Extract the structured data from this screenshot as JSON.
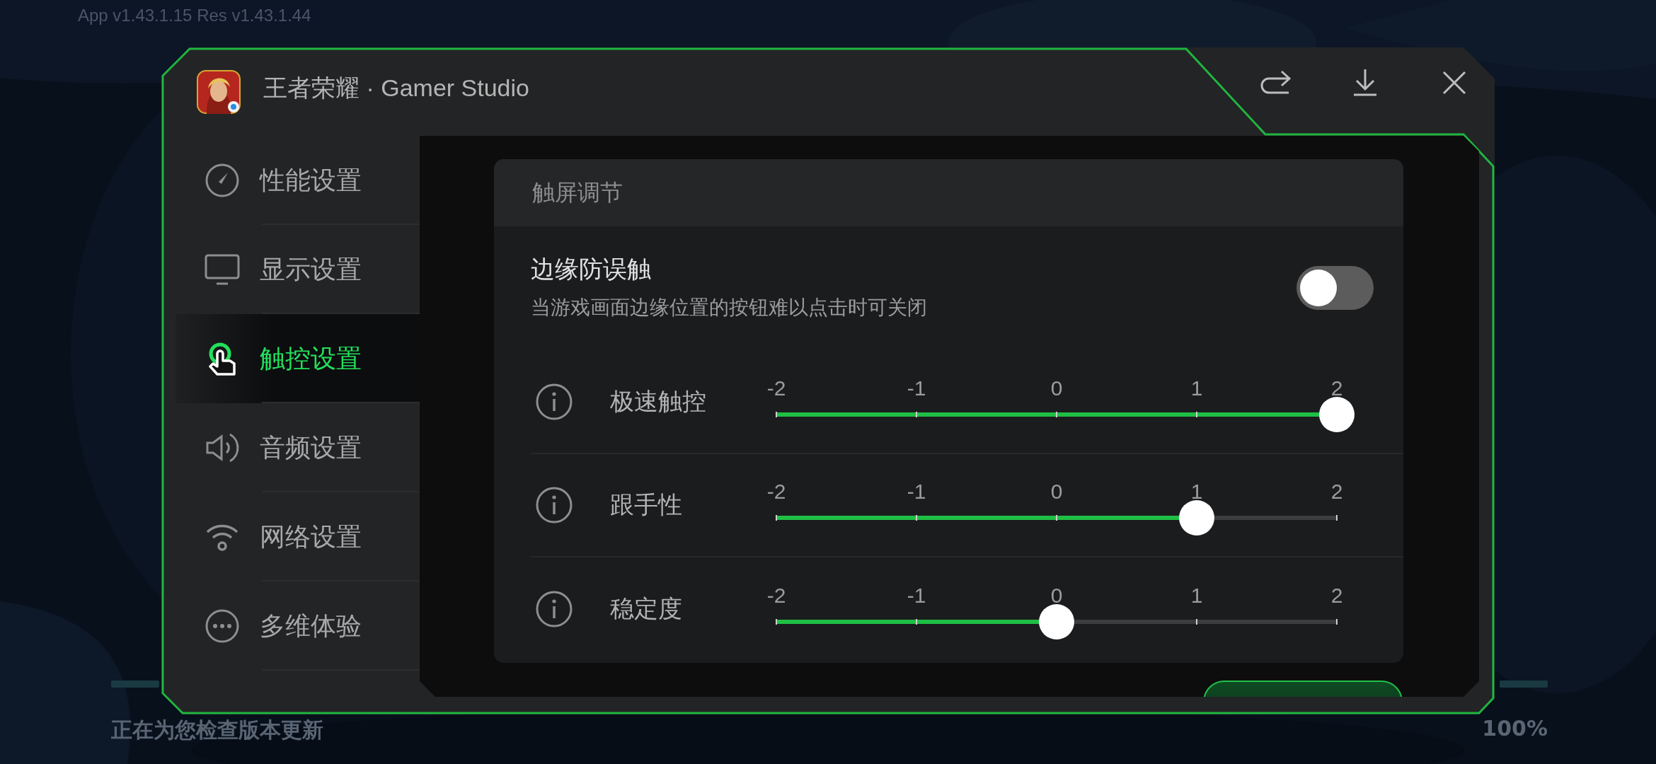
{
  "background": {
    "version": "App v1.43.1.15   Res v1.43.1.44",
    "update_text": "正在为您检查版本更新",
    "update_percent": "100%"
  },
  "window": {
    "title": "王者荣耀 · Gamer Studio",
    "actions": [
      {
        "kind": "share"
      },
      {
        "kind": "download"
      },
      {
        "kind": "close"
      }
    ]
  },
  "sidebar": {
    "items": [
      {
        "label": "性能设置",
        "selected": false
      },
      {
        "label": "显示设置",
        "selected": false
      },
      {
        "label": "触控设置",
        "selected": true
      },
      {
        "label": "音频设置",
        "selected": false
      },
      {
        "label": "网络设置",
        "selected": false
      },
      {
        "label": "多维体验",
        "selected": false
      }
    ]
  },
  "card": {
    "title": "触屏调节",
    "toggle": {
      "title": "边缘防误触",
      "description": "当游戏画面边缘位置的按钮难以点击时可关闭",
      "on": false
    },
    "sliders": [
      {
        "label": "极速触控",
        "ticks": [
          "-2",
          "-1",
          "0",
          "1",
          "2"
        ],
        "level": 1
      },
      {
        "label": "跟手性",
        "ticks": [
          "-2",
          "-1",
          "0",
          "1",
          "2"
        ],
        "level": 0.75
      },
      {
        "label": "稳定度",
        "ticks": [
          "-2",
          "-1",
          "0",
          "1",
          "2"
        ],
        "level": 0.5
      }
    ]
  }
}
